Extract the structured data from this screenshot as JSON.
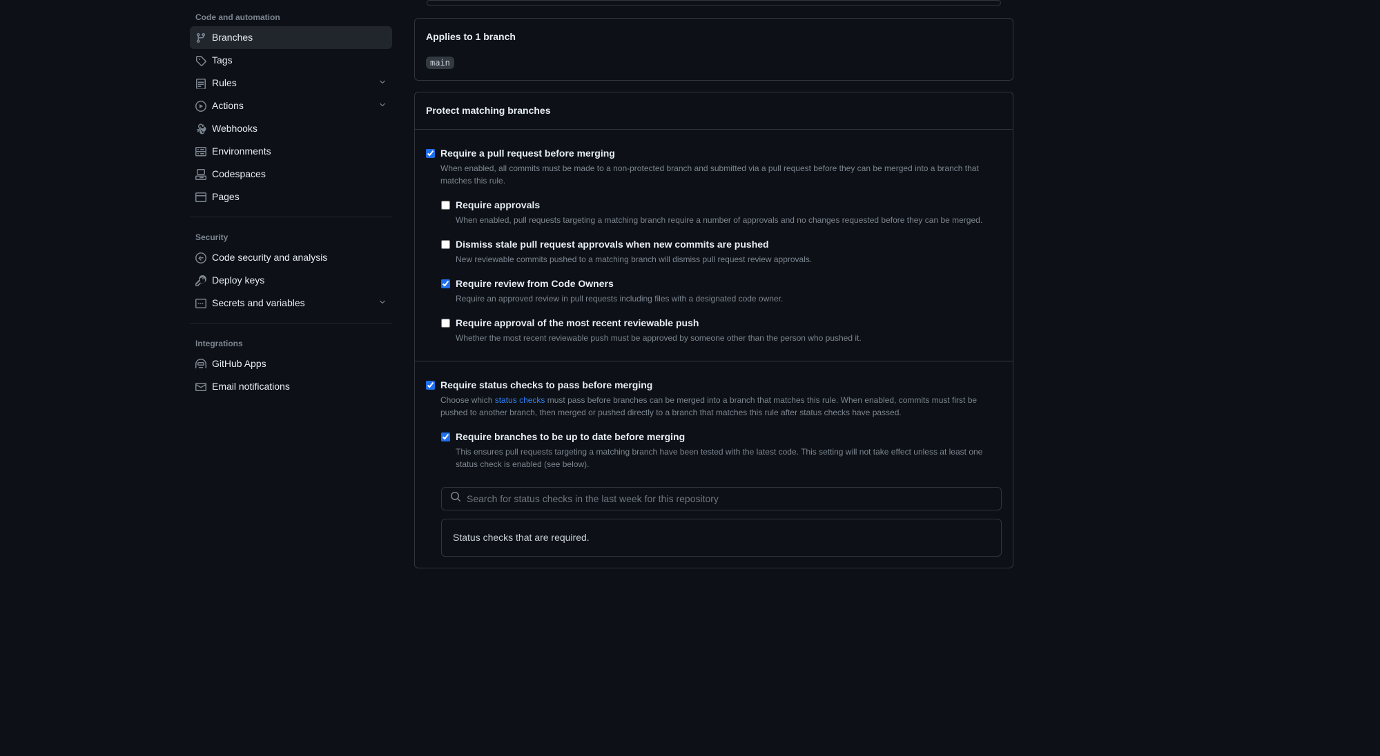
{
  "sidebar": {
    "section_code": "Code and automation",
    "items_code": [
      {
        "label": "Branches"
      },
      {
        "label": "Tags"
      },
      {
        "label": "Rules"
      },
      {
        "label": "Actions"
      },
      {
        "label": "Webhooks"
      },
      {
        "label": "Environments"
      },
      {
        "label": "Codespaces"
      },
      {
        "label": "Pages"
      }
    ],
    "section_security": "Security",
    "items_security": [
      {
        "label": "Code security and analysis"
      },
      {
        "label": "Deploy keys"
      },
      {
        "label": "Secrets and variables"
      }
    ],
    "section_integrations": "Integrations",
    "items_integrations": [
      {
        "label": "GitHub Apps"
      },
      {
        "label": "Email notifications"
      }
    ]
  },
  "main": {
    "applies_to": "Applies to 1 branch",
    "branch_name": "main",
    "protect_heading": "Protect matching branches",
    "rules": {
      "require_pr": {
        "title": "Require a pull request before merging",
        "desc": "When enabled, all commits must be made to a non-protected branch and submitted via a pull request before they can be merged into a branch that matches this rule."
      },
      "require_approvals": {
        "title": "Require approvals",
        "desc": "When enabled, pull requests targeting a matching branch require a number of approvals and no changes requested before they can be merged."
      },
      "dismiss_stale": {
        "title": "Dismiss stale pull request approvals when new commits are pushed",
        "desc": "New reviewable commits pushed to a matching branch will dismiss pull request review approvals."
      },
      "require_codeowners": {
        "title": "Require review from Code Owners",
        "desc": "Require an approved review in pull requests including files with a designated code owner."
      },
      "require_recent_push": {
        "title": "Require approval of the most recent reviewable push",
        "desc": "Whether the most recent reviewable push must be approved by someone other than the person who pushed it."
      },
      "require_status": {
        "title": "Require status checks to pass before merging",
        "desc_prefix": "Choose which ",
        "desc_link": "status checks",
        "desc_suffix": " must pass before branches can be merged into a branch that matches this rule. When enabled, commits must first be pushed to another branch, then merged or pushed directly to a branch that matches this rule after status checks have passed."
      },
      "require_up_to_date": {
        "title": "Require branches to be up to date before merging",
        "desc": "This ensures pull requests targeting a matching branch have been tested with the latest code. This setting will not take effect unless at least one status check is enabled (see below)."
      }
    },
    "search": {
      "placeholder": "Search for status checks in the last week for this repository"
    },
    "status_required": "Status checks that are required."
  }
}
